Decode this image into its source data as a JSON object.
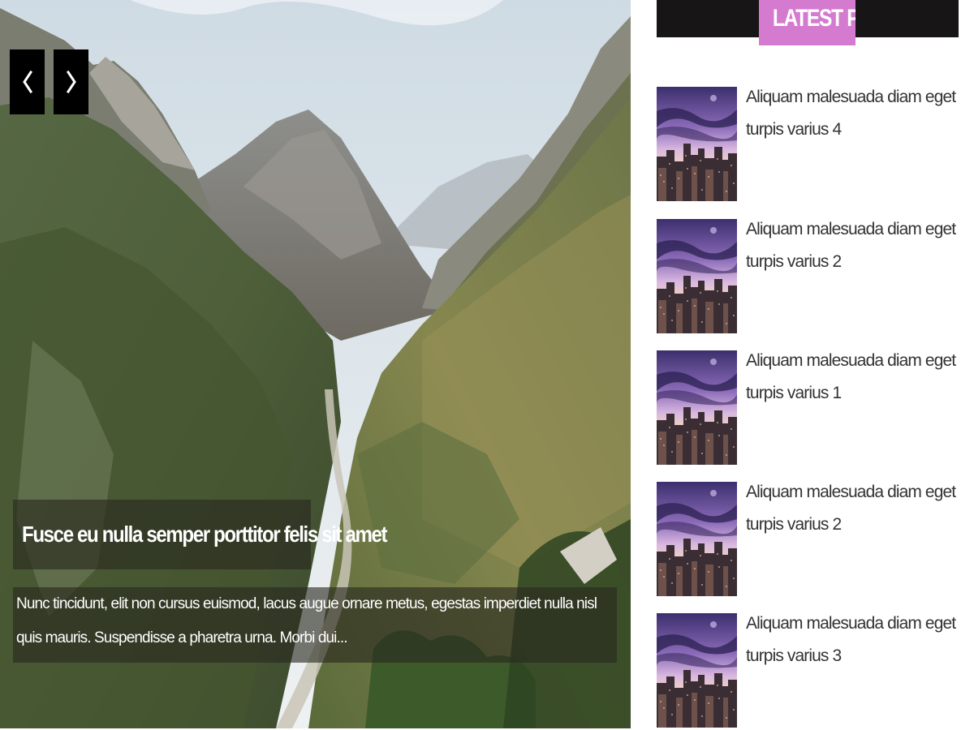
{
  "slider": {
    "prev_icon": "chevron-left-icon",
    "next_icon": "chevron-right-icon",
    "caption_title": "Fusce eu nulla semper porttitor felis sit amet",
    "caption_text": "Nunc tincidunt, elit non cursus euismod, lacus augue ornare metus, egestas imperdiet nulla nisl quis mauris. Suspendisse a pharetra urna. Morbi dui..."
  },
  "sidebar": {
    "widget_title": "LATEST POST",
    "accent_color": "#d47bd0",
    "posts": [
      {
        "title": "Aliquam malesuada diam eget turpis varius 4"
      },
      {
        "title": "Aliquam malesuada diam eget turpis varius 2"
      },
      {
        "title": "Aliquam malesuada diam eget turpis varius 1"
      },
      {
        "title": "Aliquam malesuada diam eget turpis varius 2"
      },
      {
        "title": "Aliquam malesuada diam eget turpis varius 3"
      }
    ]
  }
}
